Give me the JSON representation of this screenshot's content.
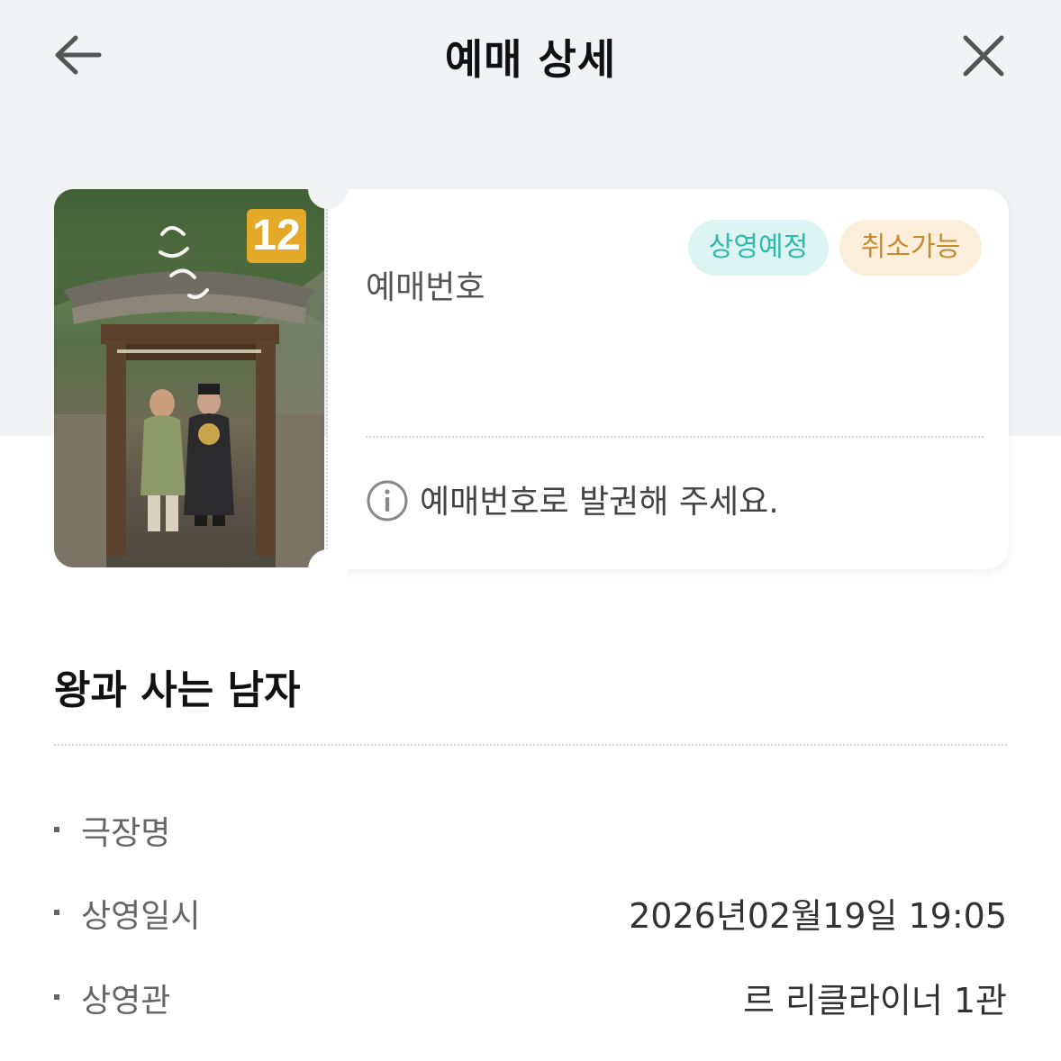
{
  "header": {
    "title": "예매 상세",
    "back_icon": "arrow-left-icon",
    "close_icon": "close-icon"
  },
  "ticket": {
    "rating": "12",
    "badges": {
      "scheduled": "상영예정",
      "cancelable": "취소가능"
    },
    "booking_number_label": "예매번호",
    "notice": "예매번호로 발권해 주세요.",
    "info_icon": "info-icon"
  },
  "movie": {
    "title": "왕과 사는 남자"
  },
  "details": [
    {
      "label": "극장명",
      "value": ""
    },
    {
      "label": "상영일시",
      "value": "2026년02월19일 19:05"
    },
    {
      "label": "상영관",
      "value": "르 리클라이너 1관"
    }
  ],
  "colors": {
    "background_top": "#f1f3f5",
    "badge_scheduled_bg": "#dcf4f2",
    "badge_scheduled_text": "#2fb8ad",
    "badge_cancel_bg": "#fbeedb",
    "badge_cancel_text": "#c98a2e",
    "rating_badge": "#e5a92a"
  }
}
